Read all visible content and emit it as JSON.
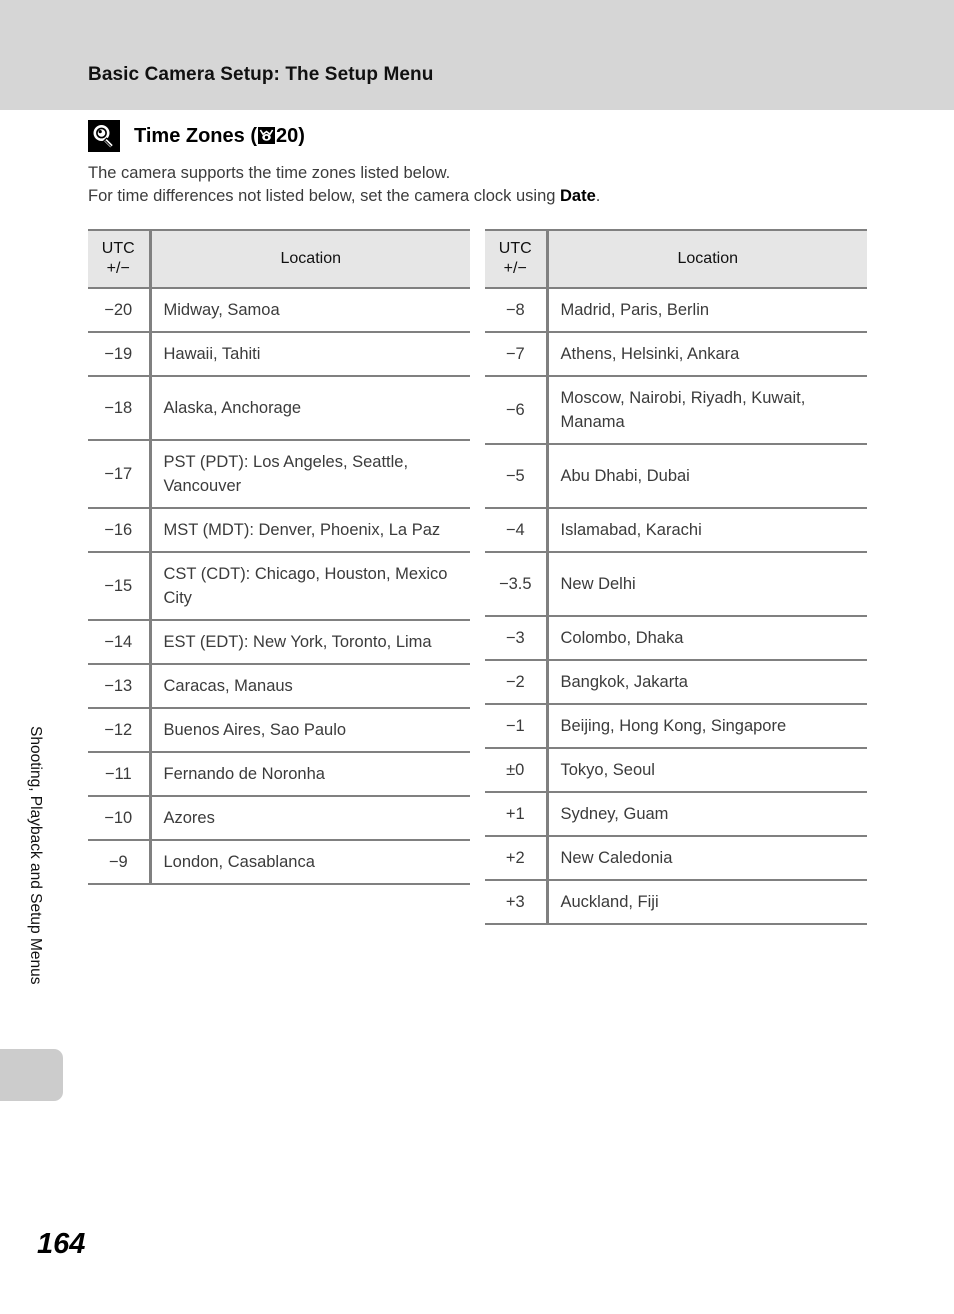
{
  "header": {
    "running_title": "Basic Camera Setup: The Setup Menu"
  },
  "section": {
    "icon": "lightbulb-tip-icon",
    "title_before_ref": "Time Zones (",
    "ref_icon": "camera-reference-icon",
    "ref_page": "20",
    "title_after_ref": ")"
  },
  "intro": {
    "line1": "The camera supports the time zones listed below.",
    "line2_before": "For time differences not listed below, set the camera clock using ",
    "line2_bold": "Date",
    "line2_after": "."
  },
  "table": {
    "headers": {
      "utc_line1": "UTC",
      "utc_line2": "+/−",
      "location": "Location"
    },
    "left_rows": [
      {
        "utc": "−20",
        "location": "Midway, Samoa",
        "tall": false
      },
      {
        "utc": "−19",
        "location": "Hawaii, Tahiti",
        "tall": false
      },
      {
        "utc": "−18",
        "location": "Alaska, Anchorage",
        "tall": true
      },
      {
        "utc": "−17",
        "location": "PST (PDT): Los Angeles, Seattle, Vancouver",
        "tall": false
      },
      {
        "utc": "−16",
        "location": "MST (MDT): Denver, Phoenix, La Paz",
        "tall": false
      },
      {
        "utc": "−15",
        "location": "CST (CDT): Chicago, Houston, Mexico City",
        "tall": false
      },
      {
        "utc": "−14",
        "location": "EST (EDT): New York, Toronto, Lima",
        "tall": false
      },
      {
        "utc": "−13",
        "location": "Caracas, Manaus",
        "tall": false
      },
      {
        "utc": "−12",
        "location": "Buenos Aires, Sao Paulo",
        "tall": false
      },
      {
        "utc": "−11",
        "location": "Fernando de Noronha",
        "tall": false
      },
      {
        "utc": "−10",
        "location": "Azores",
        "tall": false
      },
      {
        "utc": "−9",
        "location": "London, Casablanca",
        "tall": false
      }
    ],
    "right_rows": [
      {
        "utc": "−8",
        "location": "Madrid, Paris, Berlin",
        "tall": false
      },
      {
        "utc": "−7",
        "location": "Athens, Helsinki, Ankara",
        "tall": false
      },
      {
        "utc": "−6",
        "location": "Moscow, Nairobi, Riyadh, Kuwait, Manama",
        "tall": false
      },
      {
        "utc": "−5",
        "location": "Abu Dhabi, Dubai",
        "tall": true
      },
      {
        "utc": "−4",
        "location": "Islamabad, Karachi",
        "tall": false
      },
      {
        "utc": "−3.5",
        "location": "New Delhi",
        "tall": true
      },
      {
        "utc": "−3",
        "location": "Colombo, Dhaka",
        "tall": false
      },
      {
        "utc": "−2",
        "location": "Bangkok, Jakarta",
        "tall": false
      },
      {
        "utc": "−1",
        "location": "Beijing, Hong Kong, Singapore",
        "tall": false
      },
      {
        "utc": "±0",
        "location": "Tokyo, Seoul",
        "tall": false
      },
      {
        "utc": "+1",
        "location": "Sydney, Guam",
        "tall": false
      },
      {
        "utc": "+2",
        "location": "New Caledonia",
        "tall": false
      },
      {
        "utc": "+3",
        "location": "Auckland, Fiji",
        "tall": false
      }
    ]
  },
  "side": {
    "chapter_label": "Shooting, Playback and Setup Menus",
    "thumb_tab": "chapter-thumb-tab"
  },
  "footer": {
    "page_number": "164"
  },
  "colors": {
    "header_band": "#d6d6d6",
    "table_header_fill": "#e6e6e6",
    "rule": "#808080",
    "thumb_tab": "#cccccc",
    "body_text": "#3b3b3b"
  }
}
